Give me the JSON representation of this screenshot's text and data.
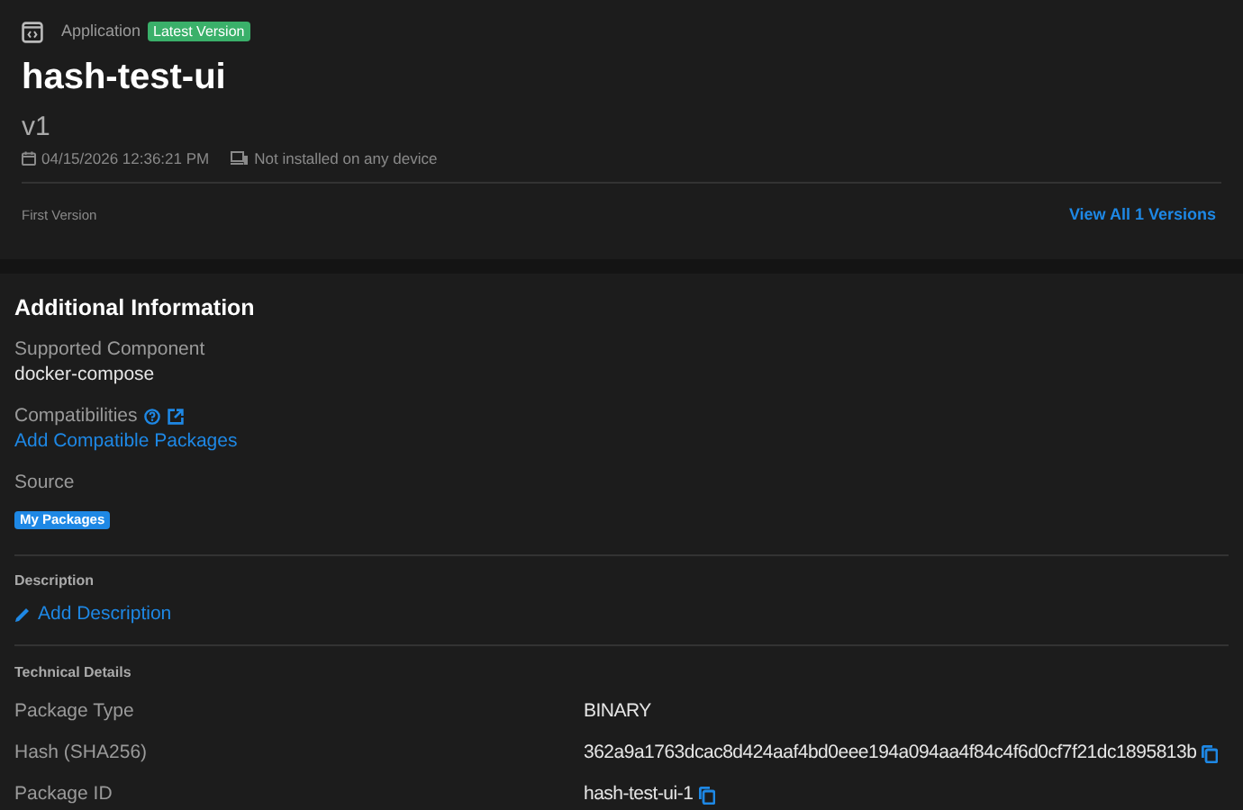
{
  "header": {
    "kind_label": "Application",
    "badge": "Latest Version",
    "title": "hash-test-ui",
    "version": "v1",
    "date": "04/15/2026 12:36:21 PM",
    "install_status": "Not installed on any device",
    "version_note": "First Version",
    "versions_link": "View All 1 Versions"
  },
  "additional_info": {
    "title": "Additional Information",
    "supported_component_label": "Supported Component",
    "supported_component": "docker-compose",
    "compatibilities_label": "Compatibilities",
    "compatibilities_link": "Add Compatible Packages",
    "source_label": "Source",
    "source_tag": "My Packages"
  },
  "description": {
    "title": "Description",
    "link": "Add Description"
  },
  "technical_details": {
    "title": "Technical Details",
    "rows": [
      {
        "label": "Package Type",
        "value": "BINARY",
        "copyable": false
      },
      {
        "label": "Hash (SHA256)",
        "value": "362a9a1763dcac8d424aaf4bd0eee194a094aa4f84c4f6d0cf7f21dc1895813b",
        "copyable": true
      },
      {
        "label": "Package ID",
        "value": "hash-test-ui-1",
        "copyable": true
      }
    ]
  }
}
